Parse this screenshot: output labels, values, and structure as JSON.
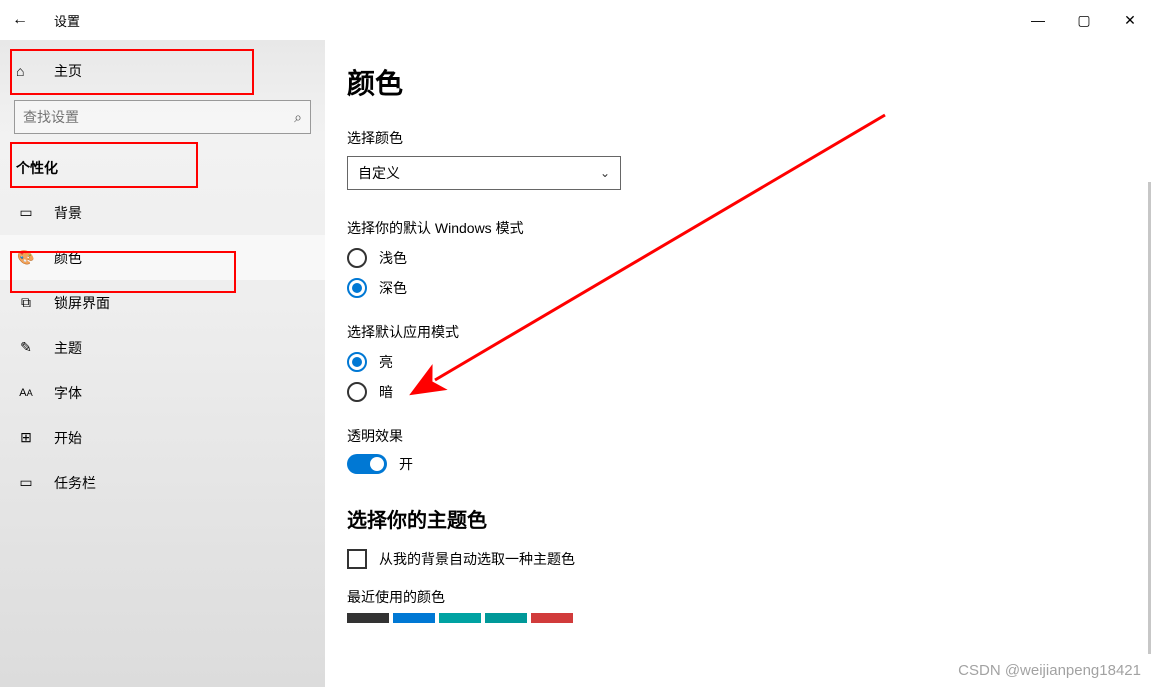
{
  "app_title": "设置",
  "sidebar": {
    "home_label": "主页",
    "search_placeholder": "查找设置",
    "category": "个性化",
    "items": [
      {
        "label": "背景",
        "icon": "picture-icon"
      },
      {
        "label": "颜色",
        "icon": "palette-icon"
      },
      {
        "label": "锁屏界面",
        "icon": "lockscreen-icon"
      },
      {
        "label": "主题",
        "icon": "theme-icon"
      },
      {
        "label": "字体",
        "icon": "font-icon"
      },
      {
        "label": "开始",
        "icon": "start-icon"
      },
      {
        "label": "任务栏",
        "icon": "taskbar-icon"
      }
    ]
  },
  "page": {
    "title": "颜色",
    "choose_color_label": "选择颜色",
    "choose_color_value": "自定义",
    "windows_mode_label": "选择你的默认 Windows 模式",
    "windows_mode_options": {
      "light": "浅色",
      "dark": "深色"
    },
    "app_mode_label": "选择默认应用模式",
    "app_mode_options": {
      "light": "亮",
      "dark": "暗"
    },
    "transparency_label": "透明效果",
    "transparency_value": "开",
    "accent_heading": "选择你的主题色",
    "auto_accent_label": "从我的背景自动选取一种主题色",
    "recent_colors_label": "最近使用的颜色",
    "recent_colors": [
      "#333333",
      "#0078d4",
      "#00a2a2",
      "#009999",
      "#d13b3b"
    ]
  },
  "watermark": "CSDN @weijianpeng18421"
}
